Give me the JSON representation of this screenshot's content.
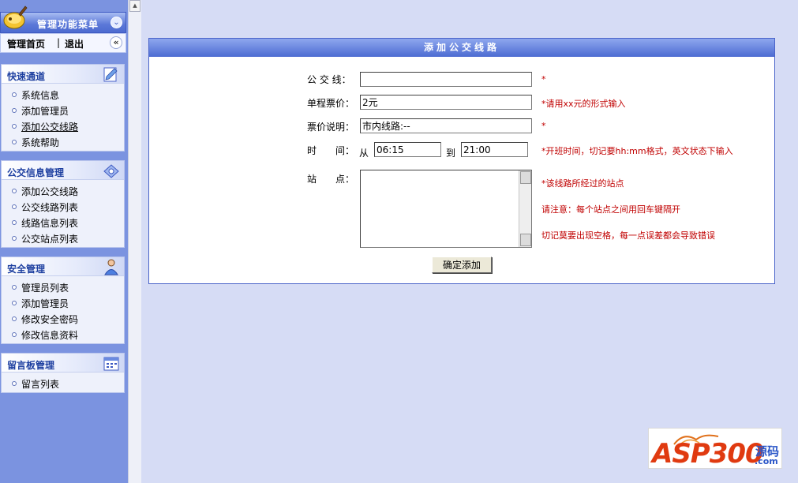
{
  "sidebar": {
    "header_title": "管理功能菜单",
    "home_label": "管理首页",
    "separator": "|",
    "logout_label": "退出",
    "sections": [
      {
        "title": "快速通道",
        "items": [
          "系统信息",
          "添加管理员",
          "添加公交线路",
          "系统帮助"
        ]
      },
      {
        "title": "公交信息管理",
        "items": [
          "添加公交线路",
          "公交线路列表",
          "线路信息列表",
          "公交站点列表"
        ]
      },
      {
        "title": "安全管理",
        "items": [
          "管理员列表",
          "添加管理员",
          "修改安全密码",
          "修改信息资料"
        ]
      },
      {
        "title": "留言板管理",
        "items": [
          "留言列表"
        ]
      }
    ]
  },
  "form": {
    "title": "添加公交线路",
    "route_label": "公 交 线：",
    "route_value": "",
    "route_hint": "*",
    "fare_label": "单程票价：",
    "fare_value": "2元",
    "fare_hint": "*请用xx元的形式输入",
    "desc_label": "票价说明：",
    "desc_value": "市内线路:--",
    "desc_hint": "*",
    "time_label": "时　　间：",
    "from_label": "从",
    "start_time": "06:15",
    "to_label": "到",
    "end_time": "21:00",
    "time_hint": "*开班时间，切记要hh:mm格式，英文状态下输入",
    "stations_label": "站　　点：",
    "stations_value": "",
    "stations_hint1": "*该线路所经过的站点",
    "stations_hint2": "请注意：每个站点之间用回车键隔开",
    "stations_hint3": "切记莫要出现空格，每一点误差都会导致错误",
    "submit_label": "确定添加"
  },
  "watermark": {
    "brand": "ASP300",
    "suffix_cn": "源码",
    "suffix_domain": ".com"
  },
  "colors": {
    "sidebar_bg": "#7b93e0",
    "page_bg": "#d6dcf5",
    "accent": "#4c6bd2",
    "hint": "#c00000"
  }
}
